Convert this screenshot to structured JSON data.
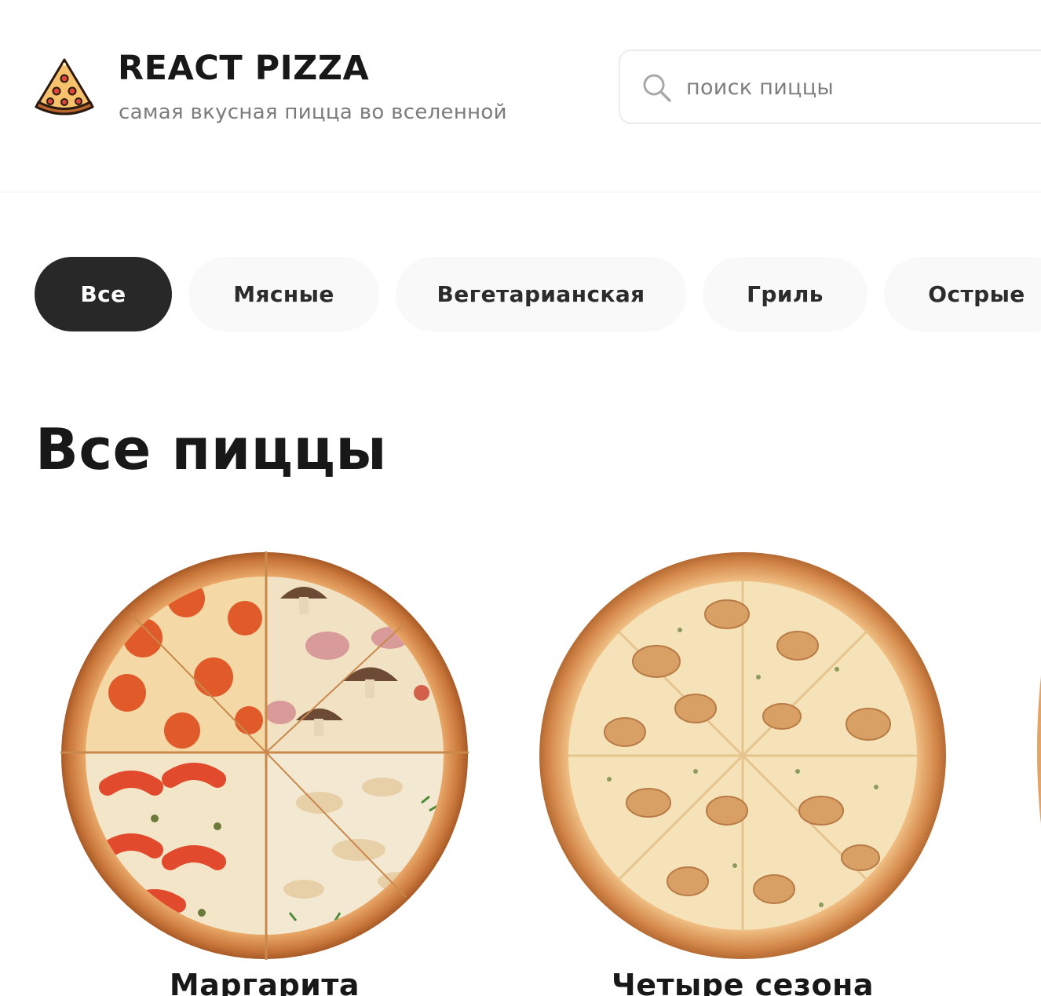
{
  "header": {
    "logo_icon": "pizza-slice-icon",
    "title": "REACT PIZZA",
    "subtitle": "самая вкусная пицца во вселенной",
    "search": {
      "icon": "search-icon",
      "placeholder": "поиск пиццы",
      "value": ""
    }
  },
  "categories": {
    "items": [
      {
        "label": "Все",
        "active": true
      },
      {
        "label": "Мясные",
        "active": false
      },
      {
        "label": "Вегетарианская",
        "active": false
      },
      {
        "label": "Гриль",
        "active": false
      },
      {
        "label": "Острые",
        "active": false
      }
    ]
  },
  "content": {
    "title": "Все пиццы",
    "pizzas": [
      {
        "name": "Маргарита"
      },
      {
        "name": "Четыре сезона"
      }
    ]
  },
  "colors": {
    "text": "#181818",
    "muted": "#7b7b7b",
    "active_category_bg": "#282828",
    "category_bg": "#f9f9f9",
    "crust": "#d98a3f",
    "cheese": "#f6dcae",
    "pepperoni": "#e2562b"
  }
}
